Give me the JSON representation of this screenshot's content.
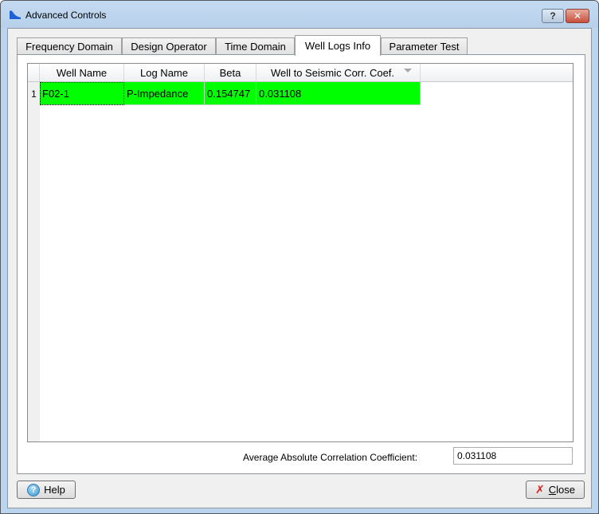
{
  "window": {
    "title": "Advanced Controls",
    "help_glyph": "?",
    "close_glyph": "✕"
  },
  "tabs": [
    {
      "label": "Frequency Domain",
      "active": false
    },
    {
      "label": "Design Operator",
      "active": false
    },
    {
      "label": "Time Domain",
      "active": false
    },
    {
      "label": "Well Logs Info",
      "active": true
    },
    {
      "label": "Parameter Test",
      "active": false
    }
  ],
  "grid": {
    "columns": [
      "Well Name",
      "Log Name",
      "Beta",
      "Well to Seismic Corr. Coef."
    ],
    "rows": [
      {
        "index": "1",
        "cells": [
          "F02-1",
          "P-Impedance",
          "0.154747",
          "0.031108"
        ],
        "highlight_color": "#00ff00"
      }
    ]
  },
  "summary": {
    "label": "Average Absolute Correlation Coefficient:",
    "value": "0.031108"
  },
  "buttons": {
    "help_label": "Help",
    "close_label": "Close"
  },
  "icons": {
    "help_button_icon": "?",
    "close_button_icon": "✗"
  }
}
